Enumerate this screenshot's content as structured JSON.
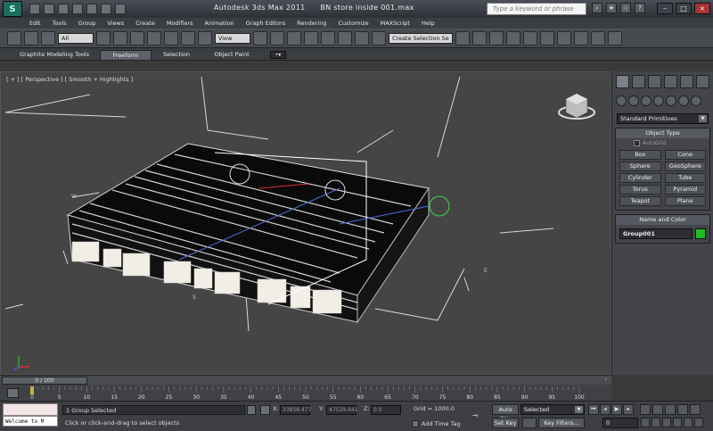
{
  "title_bar": {
    "app_title": "Autodesk 3ds Max  2011",
    "file_name": "BN store inside 001.max",
    "search_placeholder": "Type a keyword or phrase"
  },
  "menu": [
    "Edit",
    "Tools",
    "Group",
    "Views",
    "Create",
    "Modifiers",
    "Animation",
    "Graph Editors",
    "Rendering",
    "Customize",
    "MAXScript",
    "Help"
  ],
  "toolbar": {
    "selection_filter": "All",
    "reference_coord": "View",
    "named_selection_placeholder": "Create Selection Se"
  },
  "ribbon_tabs": [
    "Graphite Modeling Tools",
    "Freeform",
    "Selection",
    "Object Paint"
  ],
  "ribbon_active_tab": "Freeform",
  "viewport": {
    "label": "[ + ] [ Perspective ] [ Smooth + Highlights ]",
    "axis_labels": {
      "w": "W",
      "s": "S",
      "e": "E"
    }
  },
  "command_panel": {
    "category_dropdown": "Standard Primitives",
    "object_type_header": "Object Type",
    "autogrid_label": "AutoGrid",
    "object_buttons": [
      "Box",
      "Cone",
      "Sphere",
      "GeoSphere",
      "Cylinder",
      "Tube",
      "Torus",
      "Pyramid",
      "Teapot",
      "Plane"
    ],
    "name_color_header": "Name and Color",
    "object_name": "Group001",
    "object_color": "#1fbe25"
  },
  "time_slider": {
    "position": "0 / 100",
    "current_frame": 0,
    "total_frames": 100,
    "ticks": [
      "0",
      "5",
      "10",
      "15",
      "20",
      "25",
      "30",
      "35",
      "40",
      "45",
      "50",
      "55",
      "60",
      "65",
      "70",
      "75",
      "80",
      "85",
      "90",
      "95",
      "100"
    ]
  },
  "status_bar": {
    "maxscript_text": "Welcome to M",
    "selection_status": "1 Group Selected",
    "prompt": "Click or click-and-drag to select objects",
    "x_label": "X:",
    "x_value": "33858.477",
    "y_label": "Y:",
    "y_value": "47529.441",
    "z_label": "Z:",
    "z_value": "0.0",
    "grid": "Grid = 1000.0",
    "add_time_tag": "Add Time Tag",
    "auto_key": "Auto Key",
    "set_key": "Set Key",
    "key_mode": "Selected",
    "key_filters": "Key Filters...",
    "frame": "0"
  },
  "colors": {
    "viewport_bg": "#454545",
    "selection_bbox": "#ffffff",
    "object_color": "#1fbe25"
  }
}
